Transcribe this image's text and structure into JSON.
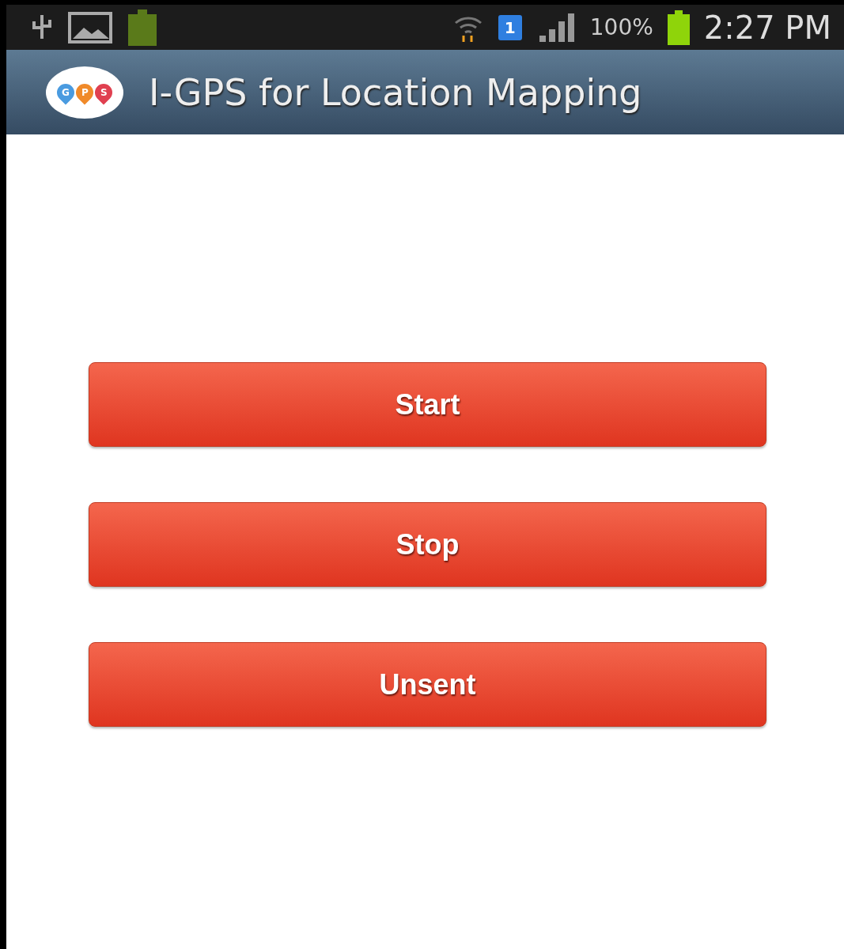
{
  "status_bar": {
    "sim_badge": "1",
    "battery_percent": "100%",
    "time": "2:27 PM"
  },
  "app_bar": {
    "logo_letters": [
      "G",
      "P",
      "S"
    ],
    "title": "I-GPS for Location Mapping"
  },
  "buttons": [
    "Start",
    "Stop",
    "Unsent"
  ]
}
